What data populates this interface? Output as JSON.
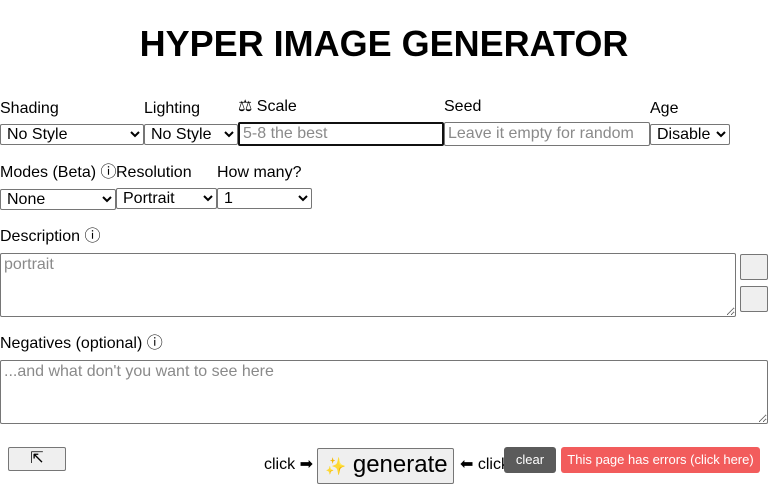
{
  "title": "HYPER IMAGE GENERATOR",
  "shading": {
    "icon": "",
    "label": "Shading",
    "value": "No Style"
  },
  "lighting": {
    "icon": "",
    "label": "Lighting",
    "value": "No Style"
  },
  "scale": {
    "icon": "⚖",
    "label": "Scale",
    "placeholder": "5-8 the best"
  },
  "seed": {
    "icon": "",
    "label": "Seed",
    "placeholder": "Leave it empty for random"
  },
  "age": {
    "icon": "",
    "label": "Age",
    "value": "Disable"
  },
  "modes": {
    "label": "Modes (Beta)",
    "info": "ⓘ",
    "value": "None"
  },
  "resolution": {
    "label": "Resolution",
    "value": "Portrait"
  },
  "how_many": {
    "icon": "",
    "label": "How many?",
    "value": "1"
  },
  "description": {
    "icon": "",
    "label": "Description",
    "info": "ⓘ",
    "placeholder": "portrait",
    "side_btn_1": "",
    "side_btn_2": ""
  },
  "negatives": {
    "icon": "",
    "label": "Negatives (optional)",
    "info": "ⓘ",
    "placeholder": "...and what don't you want to see here"
  },
  "footer": {
    "expand_icon": "⇱",
    "click_left": "click",
    "arrow_right": "➡",
    "generate_icon": "✨",
    "generate_label": "generate",
    "arrow_left": "⬅",
    "click_right": "click",
    "clear_icon": "",
    "clear_label": "clear",
    "errors_label": "This page has errors (click here)"
  },
  "colors": {
    "clear_bg": "#5b5b5b",
    "errors_bg": "#f25c5c"
  }
}
